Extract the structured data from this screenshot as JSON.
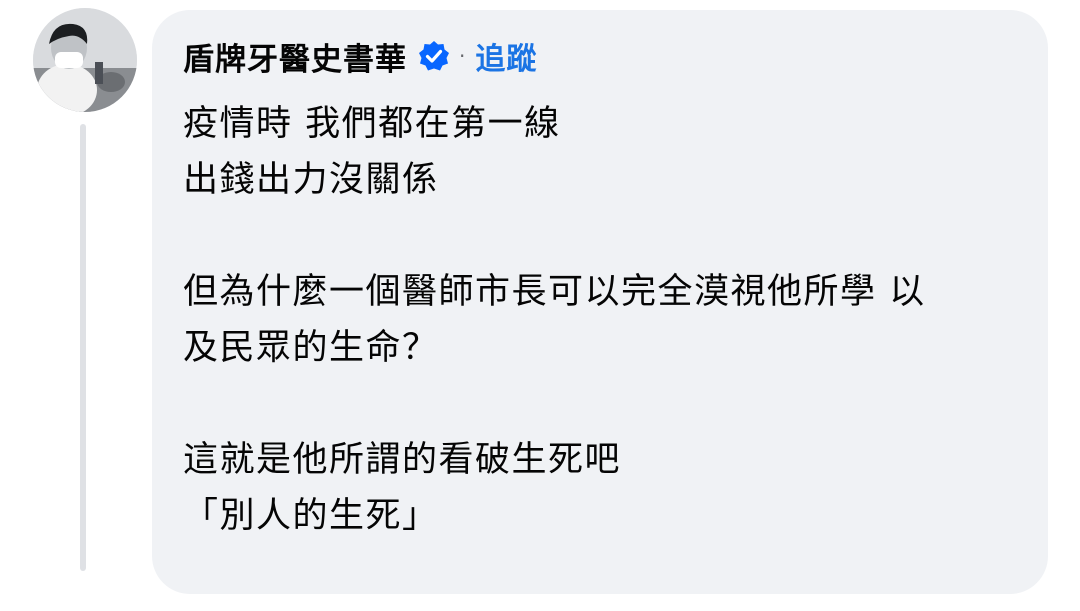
{
  "comment": {
    "author": "盾牌牙醫史書華",
    "separator": "·",
    "follow_label": "追蹤",
    "lines": [
      "疫情時 我們都在第一線",
      "出錢出力沒關係",
      "",
      "但為什麼一個醫師市長可以完全漠視他所學 以",
      "及民眾的生命？",
      "",
      "這就是他所謂的看破生死吧",
      "「別人的生死」"
    ]
  },
  "icons": {
    "avatar": "profile-photo",
    "verified": "verified-badge-icon"
  },
  "colors": {
    "bubble": "#f0f2f5",
    "follow_link": "#1b74e4",
    "verified_badge": "#0866ff",
    "thread_line": "#dfe1e5",
    "text": "#050505"
  }
}
